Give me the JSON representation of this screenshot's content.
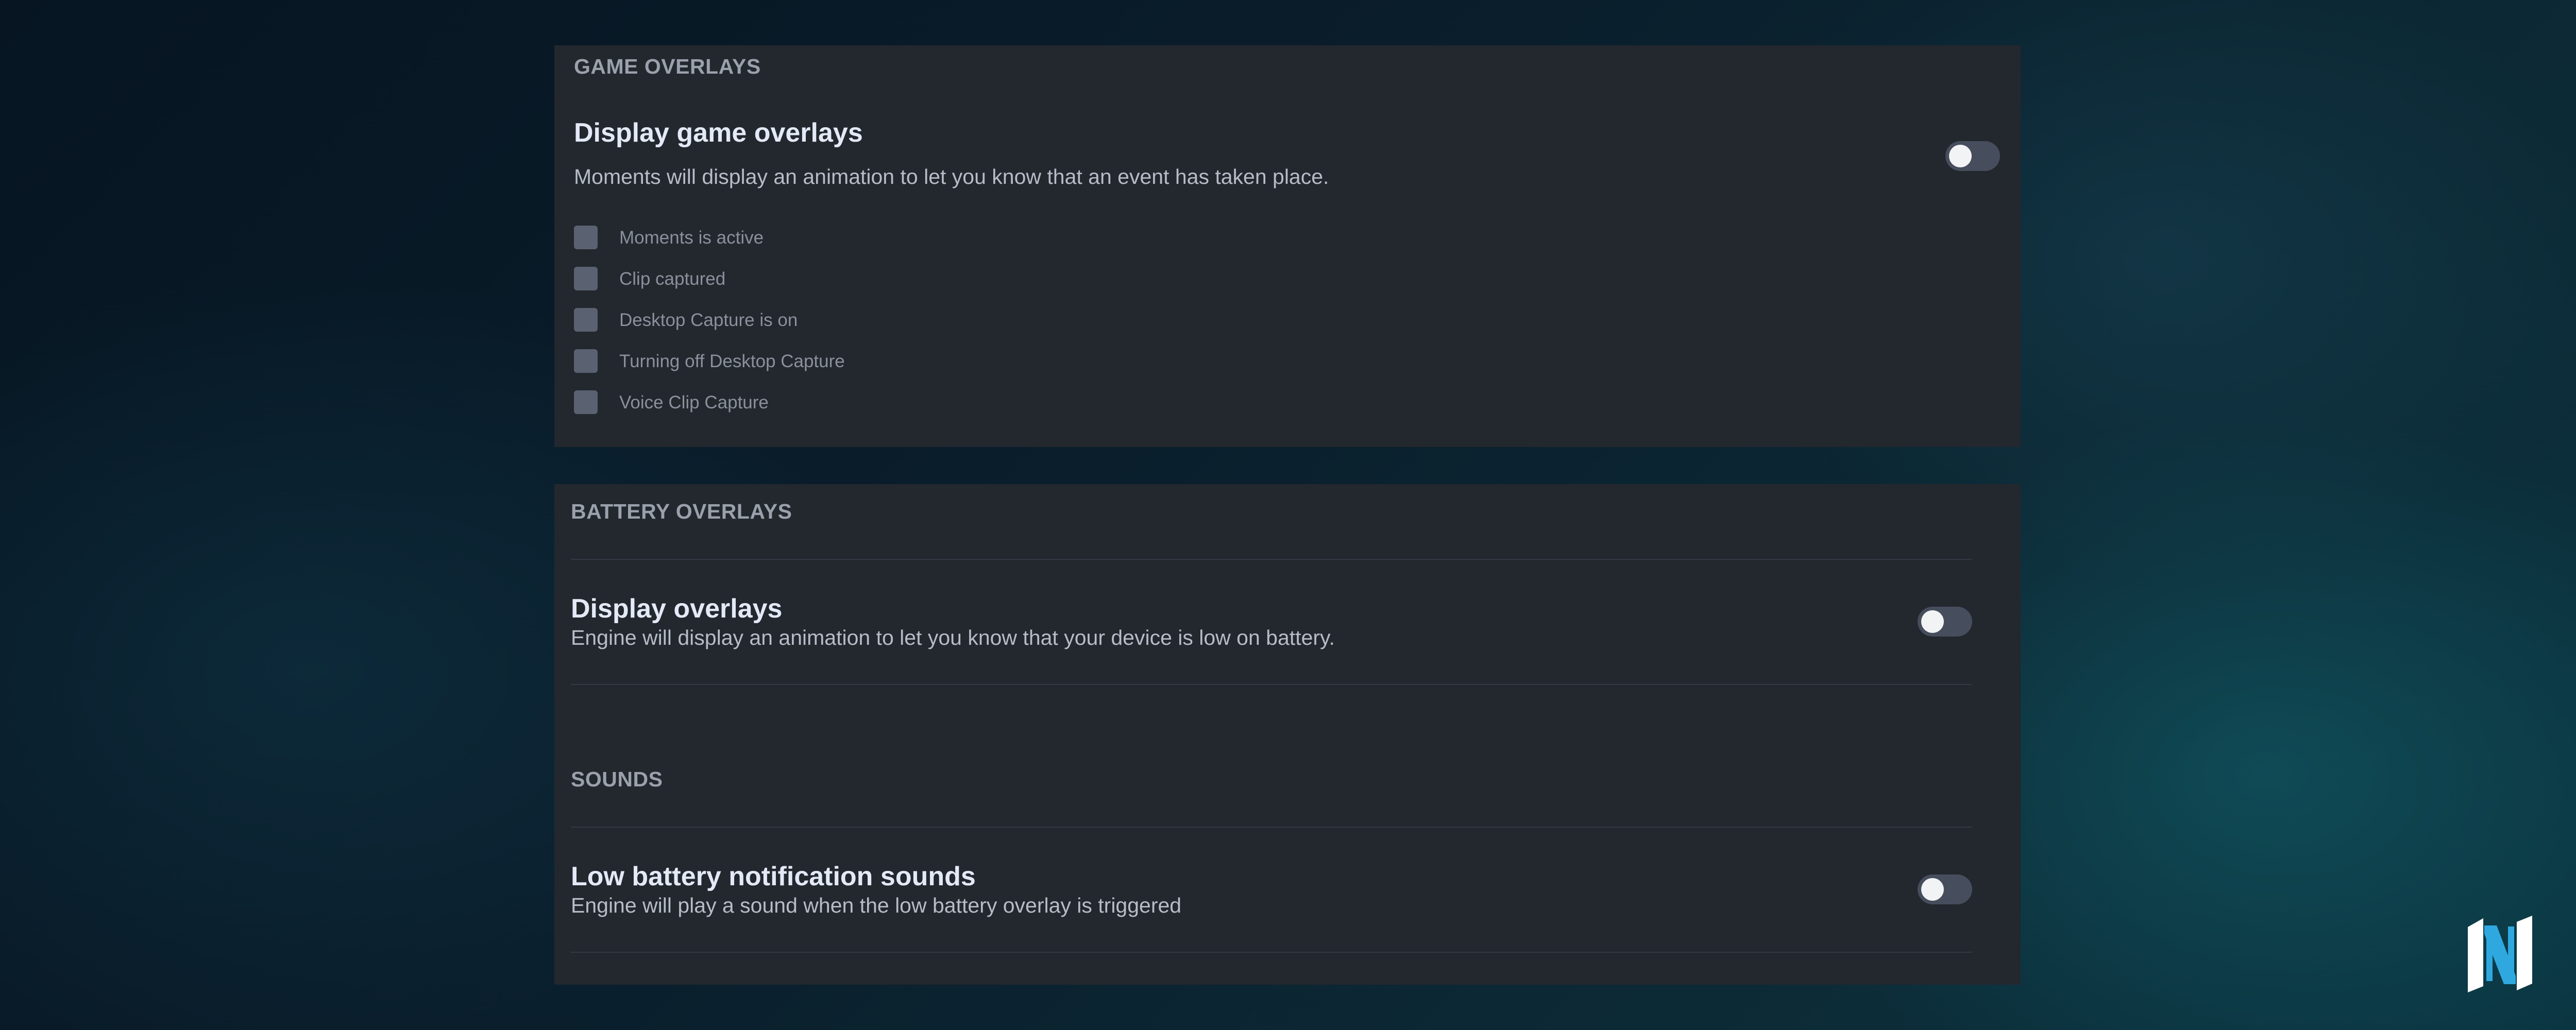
{
  "game_overlays": {
    "section_title": "GAME OVERLAYS",
    "title": "Display game overlays",
    "description": "Moments will display an animation to let you know that an event has taken place.",
    "toggle_on": false,
    "options": [
      {
        "label": "Moments is active",
        "checked": false
      },
      {
        "label": "Clip captured",
        "checked": false
      },
      {
        "label": "Desktop Capture is on",
        "checked": false
      },
      {
        "label": "Turning off Desktop Capture",
        "checked": false
      },
      {
        "label": "Voice Clip Capture",
        "checked": false
      }
    ]
  },
  "battery_overlays": {
    "section_title": "BATTERY OVERLAYS",
    "title": "Display overlays",
    "description": "Engine will display an animation to let you know that your device is low on battery.",
    "toggle_on": false
  },
  "sounds": {
    "section_title": "SOUNDS",
    "title": "Low battery notification sounds",
    "description": "Engine will play a sound when the low battery overlay is triggered",
    "toggle_on": false
  },
  "logo": {
    "icon": "n-logo-icon",
    "colors": [
      "#ffffff",
      "#2fa8e0"
    ]
  }
}
